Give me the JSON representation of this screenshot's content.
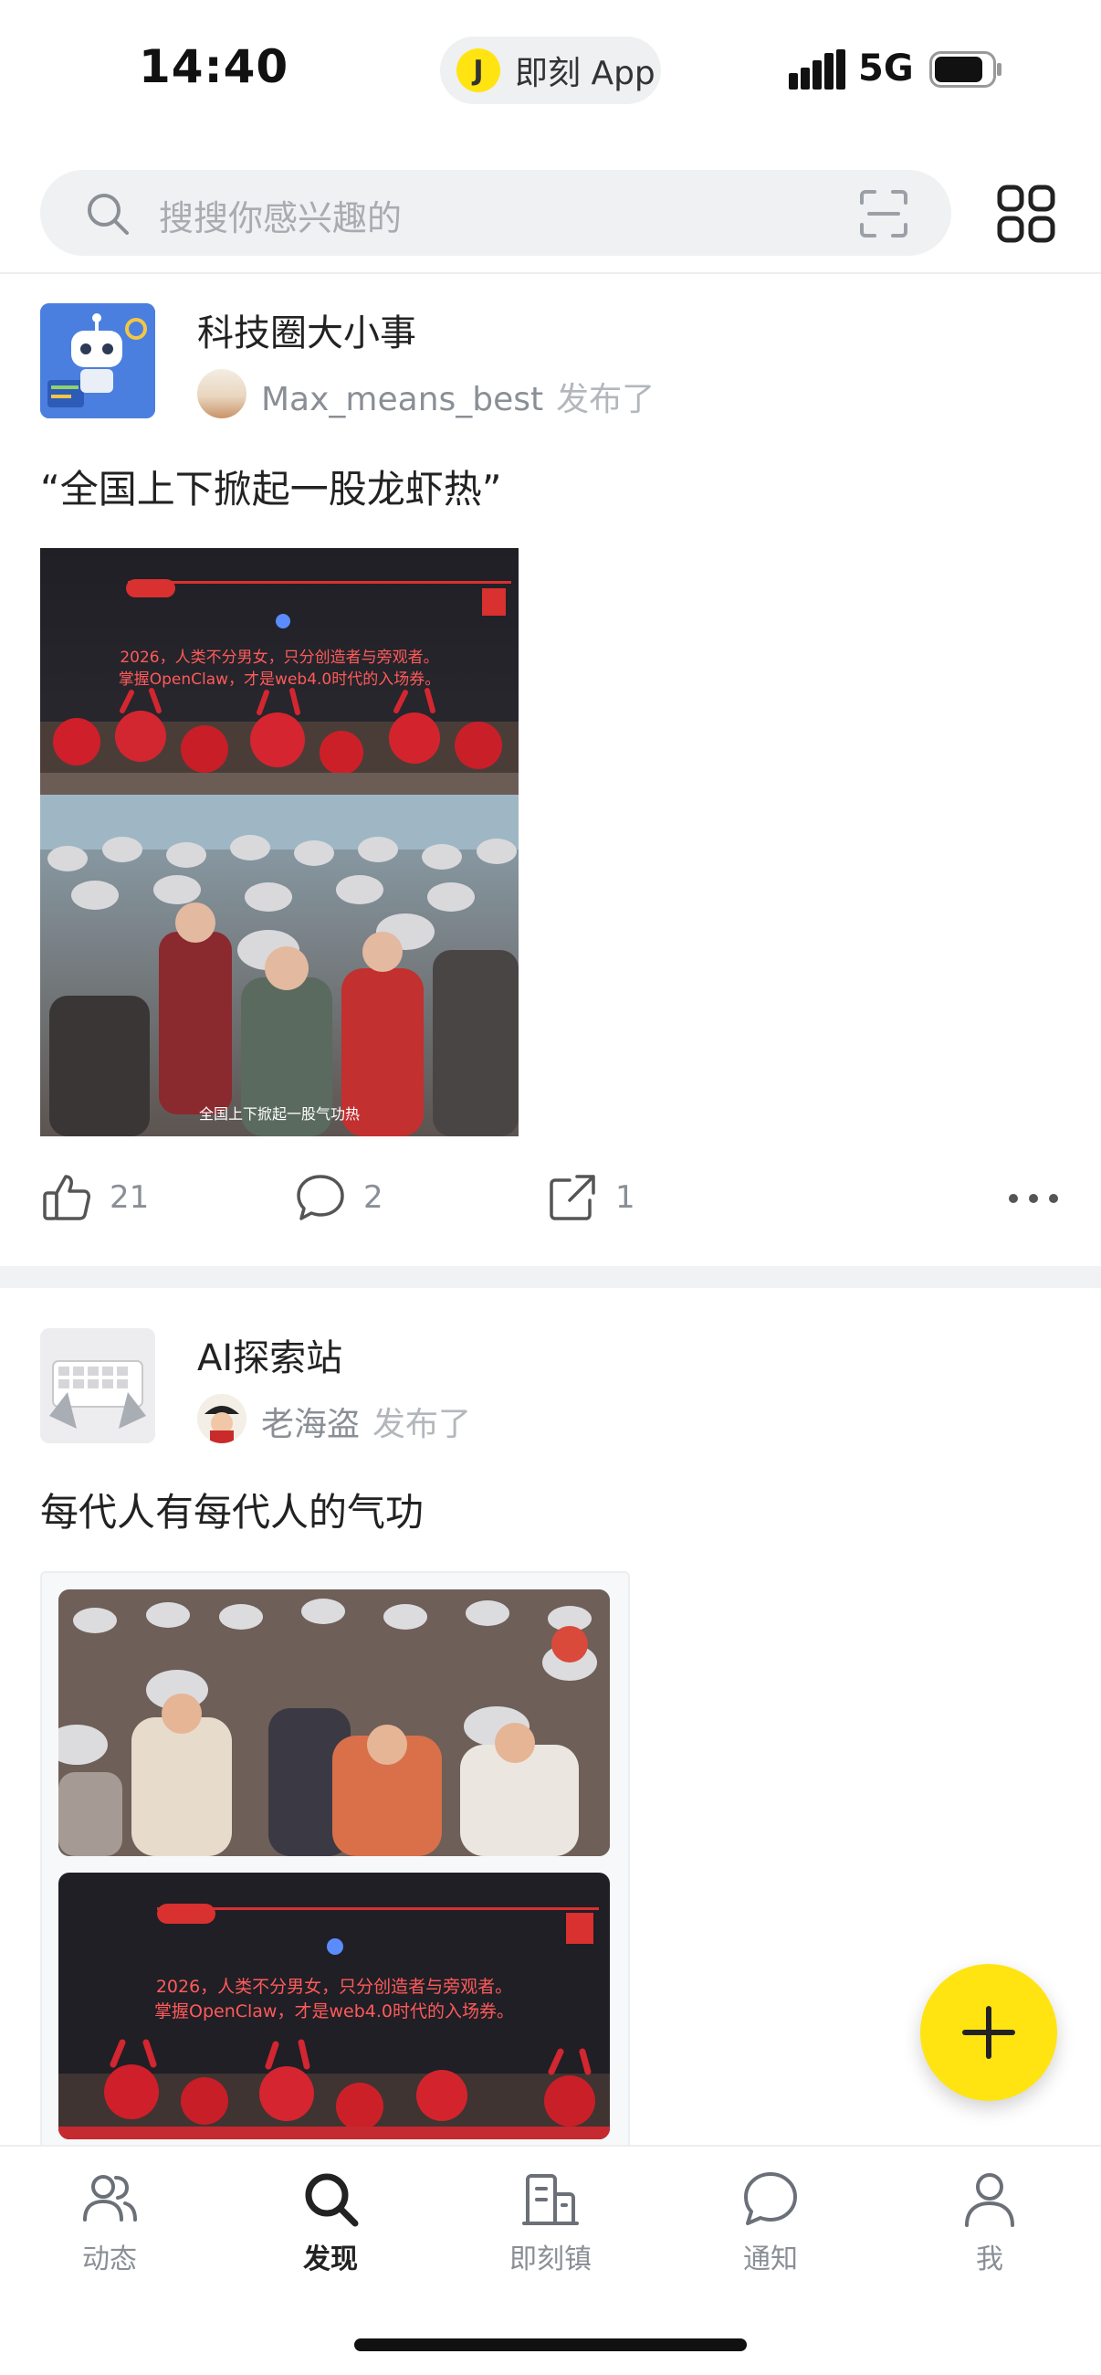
{
  "status_bar": {
    "time": "14:40",
    "app_logo_letter": "J",
    "app_name": "即刻 App",
    "network": "5G"
  },
  "search": {
    "placeholder": "搜搜你感兴趣的"
  },
  "posts": [
    {
      "topic": "科技圈大小事",
      "user": "Max_means_best",
      "published": "发布了",
      "text": "“全国上下掀起一股龙虾热”",
      "image_caption_top": "2026，人类不分男女，只分创造者与旁观者。",
      "image_caption_mid": "掌握OpenClaw，才是web4.0时代的入场券。",
      "image_caption_bottom": "全国上下掀起一股气功热",
      "likes": "21",
      "comments": "2",
      "shares": "1"
    },
    {
      "topic": "AI探索站",
      "user": "老海盗",
      "published": "发布了",
      "text": "每代人有每代人的气功",
      "image_caption_top": "2026，人类不分男女，只分创造者与旁观者。",
      "image_caption_mid": "掌握OpenClaw，才是web4.0时代的入场券。"
    }
  ],
  "tabs": [
    {
      "label": "动态",
      "icon": "people-icon"
    },
    {
      "label": "发现",
      "icon": "search-icon",
      "active": true
    },
    {
      "label": "即刻镇",
      "icon": "building-icon"
    },
    {
      "label": "通知",
      "icon": "chat-bubble-icon"
    },
    {
      "label": "我",
      "icon": "person-icon"
    }
  ],
  "colors": {
    "accent_yellow": "#ffe411",
    "text_primary": "#222222",
    "text_secondary": "#8a8f96",
    "search_bg": "#eff1f3"
  }
}
